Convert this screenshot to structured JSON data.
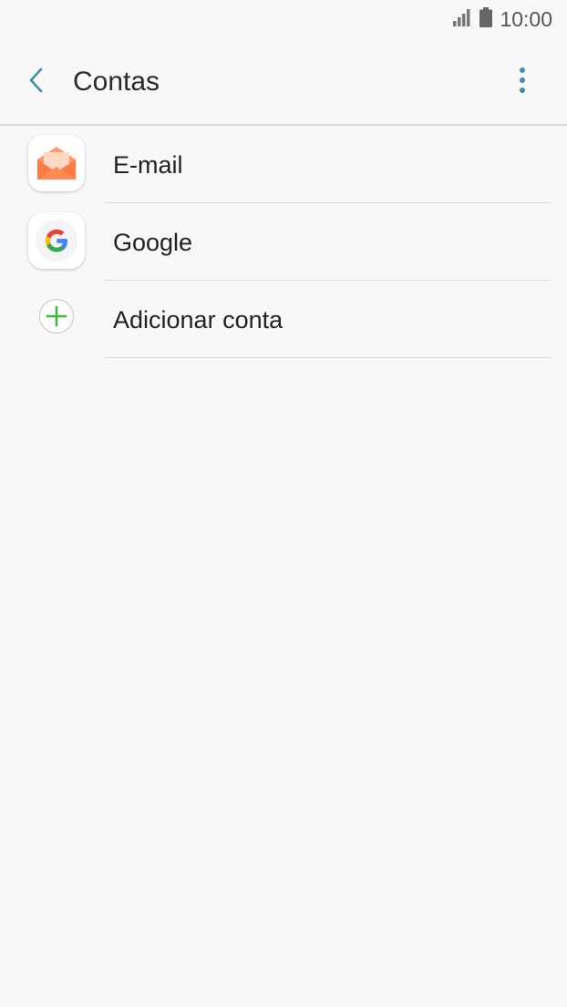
{
  "status_bar": {
    "time": "10:00",
    "signal_icon": "signal-icon",
    "battery_icon": "battery-icon"
  },
  "action_bar": {
    "title": "Contas",
    "back_icon": "back-arrow-icon",
    "more_icon": "more-vert-icon",
    "accent_color": "#3d8fb5"
  },
  "accounts": {
    "items": [
      {
        "label": "E-mail",
        "icon": "email-icon"
      },
      {
        "label": "Google",
        "icon": "google-icon"
      },
      {
        "label": "Adicionar conta",
        "icon": "add-circle-icon"
      }
    ]
  },
  "colors": {
    "background": "#f8f8f8",
    "email_orange": "#ff8a5c",
    "add_green": "#3cb93c"
  }
}
